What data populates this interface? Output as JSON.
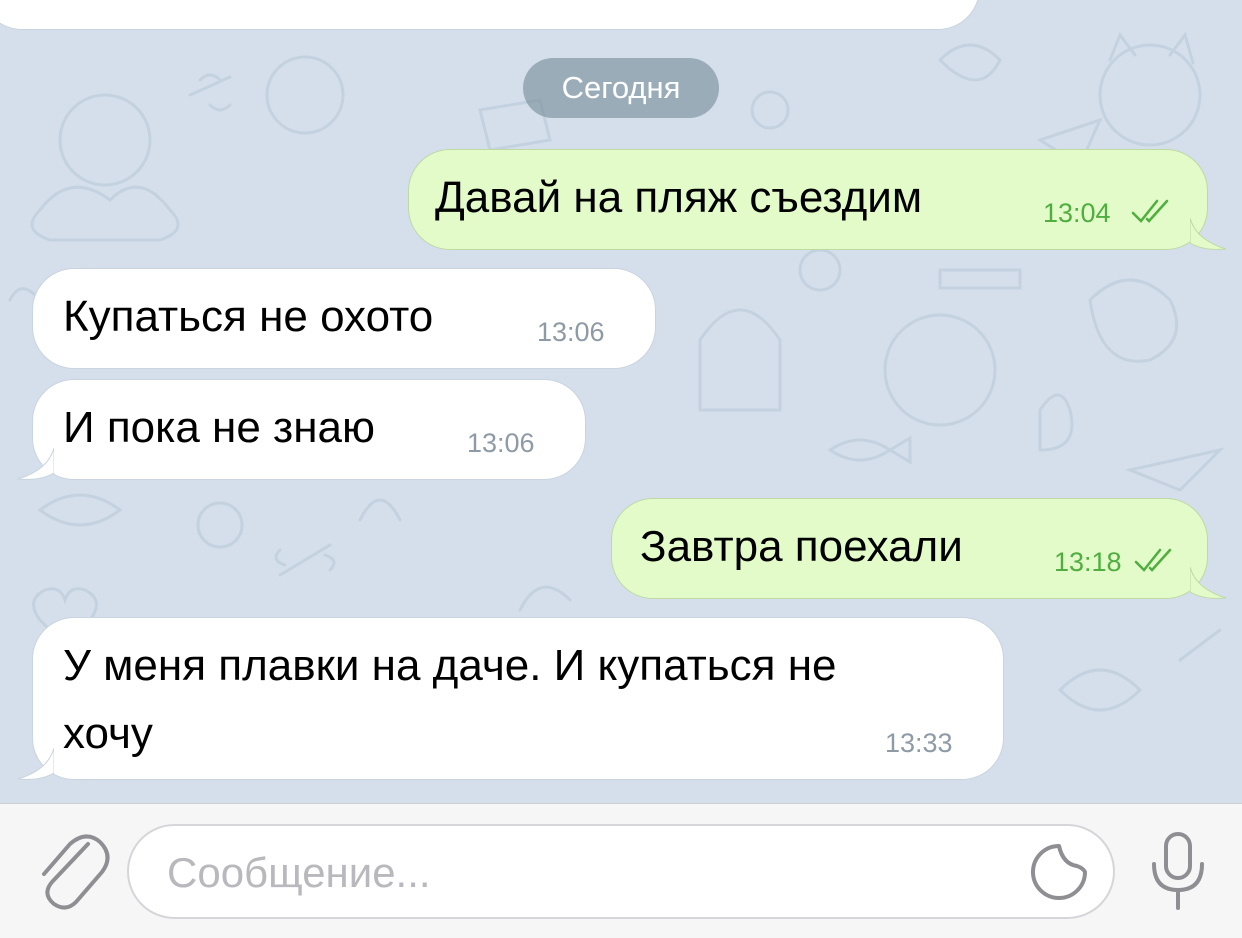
{
  "date_divider": "Сегодня",
  "messages": [
    {
      "direction": "out",
      "text": "Давай на пляж съездим",
      "time": "13:04",
      "status": "read"
    },
    {
      "direction": "in",
      "text": "Купаться не охото",
      "time": "13:06"
    },
    {
      "direction": "in",
      "text": "И пока не знаю",
      "time": "13:06"
    },
    {
      "direction": "out",
      "text": "Завтра поехали",
      "time": "13:18",
      "status": "read"
    },
    {
      "direction": "in",
      "text_line1": "У меня плавки на даче. И купаться не",
      "text_line2": "хочу",
      "time": "13:33"
    }
  ],
  "input": {
    "placeholder": "Сообщение..."
  },
  "icons": {
    "attach": "paperclip-icon",
    "sticker": "sticker-icon",
    "voice": "microphone-icon",
    "read_status": "double-check-icon"
  },
  "colors": {
    "chat_background": "#d4dfeb",
    "outgoing_bubble": "#e2fbc9",
    "incoming_bubble": "#ffffff",
    "outgoing_time": "#4fae3f",
    "icon_gray": "#8e8e93"
  }
}
